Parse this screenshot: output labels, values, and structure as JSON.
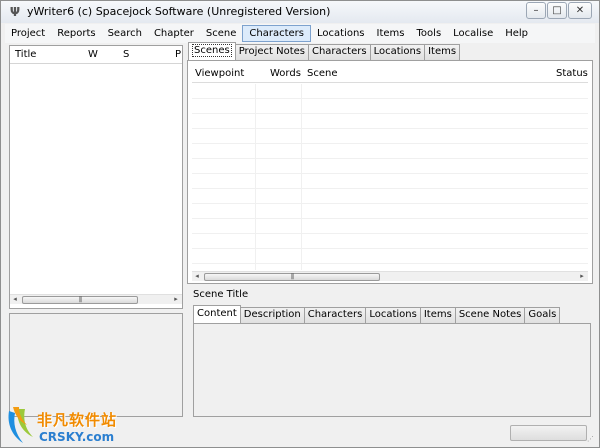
{
  "window": {
    "title": "yWriter6 (c) Spacejock Software (Unregistered Version)",
    "icon": "app-icon",
    "min_glyph": "–",
    "max_glyph": "□",
    "close_glyph": "✕"
  },
  "menu": [
    "Project",
    "Reports",
    "Search",
    "Chapter",
    "Scene",
    "Characters",
    "Locations",
    "Items",
    "Tools",
    "Localise",
    "Help"
  ],
  "menu_active": "Characters",
  "left": {
    "columns": [
      "Title",
      "W",
      "S",
      "P"
    ]
  },
  "top_tabs": [
    "Scenes",
    "Project Notes",
    "Characters",
    "Locations",
    "Items"
  ],
  "top_tab_selected": "Scenes",
  "scenes_grid": {
    "columns": [
      "Viewpoint",
      "Words",
      "Scene",
      "Status"
    ]
  },
  "scene_title_label": "Scene Title",
  "bottom_tabs": [
    "Content",
    "Description",
    "Characters",
    "Locations",
    "Items",
    "Scene Notes",
    "Goals"
  ],
  "bottom_tab_selected": "Content",
  "watermark": {
    "cn": "非凡软件站",
    "en": "CRSKY.com"
  },
  "glyphs": {
    "left_arrow": "◂",
    "right_arrow": "▸",
    "thumb_grip": "|||",
    "resize_grip": "⋰"
  }
}
